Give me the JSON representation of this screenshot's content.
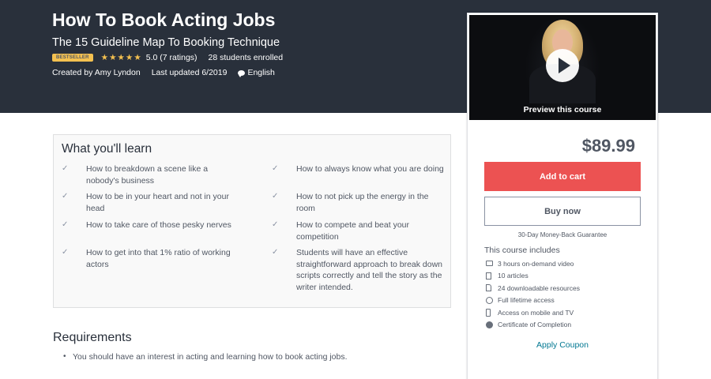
{
  "course": {
    "title": "How To Book Acting Jobs",
    "subtitle": "The 15 Guideline Map To Booking Technique",
    "badge": "BESTSELLER",
    "stars": "★★★★★",
    "rating": "5.0 (7 ratings)",
    "enrolled": "28 students enrolled",
    "created_by": "Created by Amy Lyndon",
    "last_updated": "Last updated 6/2019",
    "language": "English"
  },
  "preview": {
    "label": "Preview this course"
  },
  "purchase": {
    "price": "$89.99",
    "add_to_cart": "Add to cart",
    "buy_now": "Buy now",
    "guarantee": "30-Day Money-Back Guarantee",
    "includes_title": "This course includes",
    "includes": [
      {
        "icon": "video-icon",
        "text": "3 hours on-demand video"
      },
      {
        "icon": "article-icon",
        "text": "10 articles"
      },
      {
        "icon": "resource-icon",
        "text": "24 downloadable resources"
      },
      {
        "icon": "infinity-icon",
        "text": "Full lifetime access"
      },
      {
        "icon": "mobile-icon",
        "text": "Access on mobile and TV"
      },
      {
        "icon": "certificate-icon",
        "text": "Certificate of Completion"
      }
    ],
    "coupon": "Apply Coupon"
  },
  "learn": {
    "title": "What you'll learn",
    "check": "✓",
    "items": [
      "How to breakdown a scene like a nobody's business",
      "How to always know what you are doing",
      "How to be in your heart and not in your head",
      "How to not pick up the energy in the room",
      "How to take care of those pesky nerves",
      "How to compete and beat your competition",
      "How to get into that 1% ratio of working actors",
      "Students will have an effective straightforward approach to break down scripts correctly and tell the story as the writer intended."
    ]
  },
  "requirements": {
    "title": "Requirements",
    "bullet": "•",
    "items": [
      "You should have an interest in acting and learning how to book acting jobs."
    ]
  },
  "colors": {
    "hero_bg": "#29303b",
    "cart_button": "#ec5252",
    "star": "#f4c150",
    "link": "#007791"
  }
}
